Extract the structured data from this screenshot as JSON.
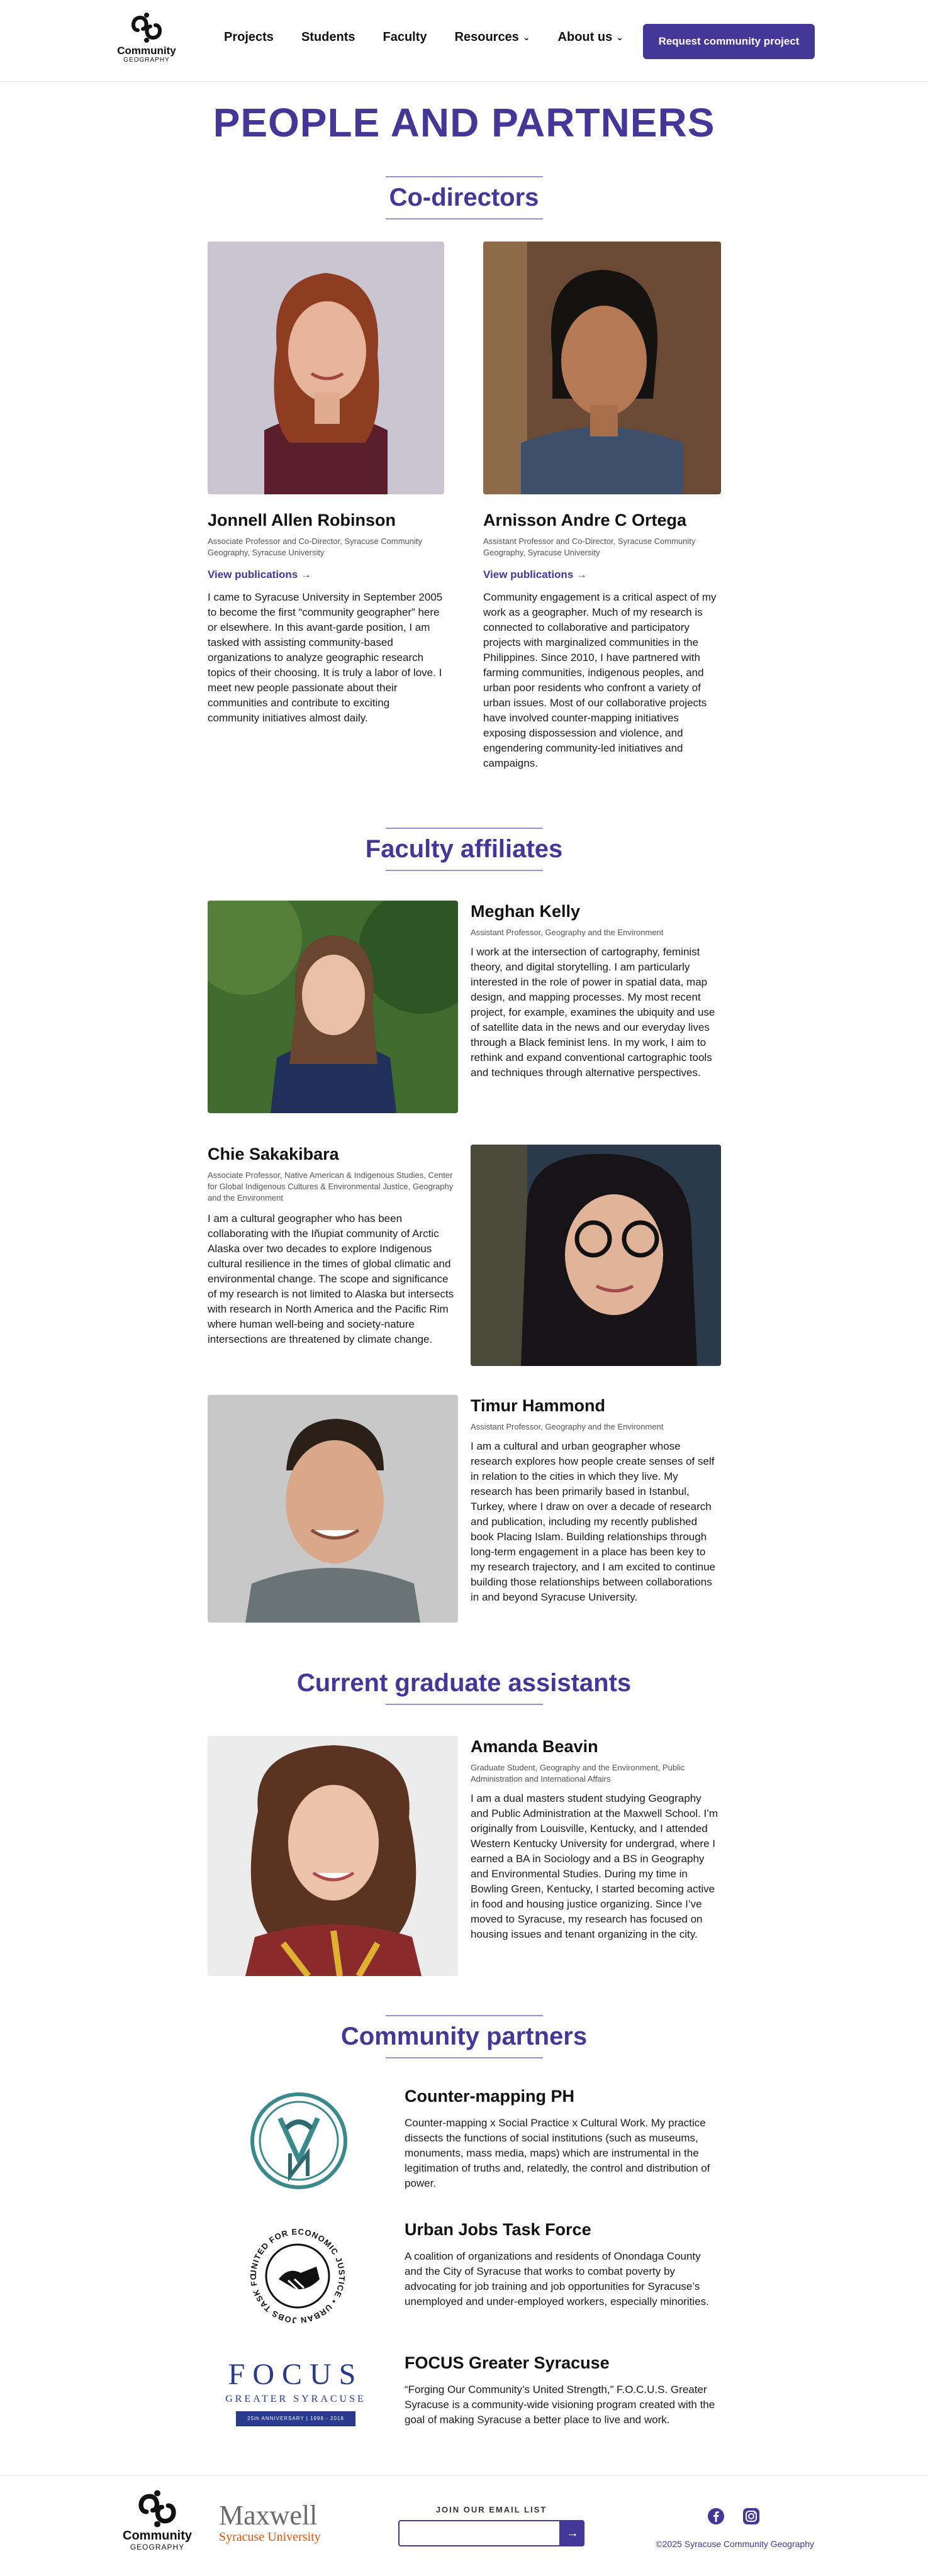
{
  "header": {
    "logo_line1": "Community",
    "logo_line2": "GEOGRAPHY",
    "nav": [
      {
        "label": "Projects"
      },
      {
        "label": "Students"
      },
      {
        "label": "Faculty"
      },
      {
        "label": "Resources",
        "chevron": "chevron-down-icon"
      },
      {
        "label": "About us",
        "chevron": "chevron-down-icon"
      }
    ],
    "cta_label": "Request community project"
  },
  "page_title": "PEOPLE AND PARTNERS",
  "codirectors": {
    "heading": "Co-directors",
    "people": [
      {
        "name": "Jonnell Allen Robinson",
        "role": "Associate Professor and Co-Director, Syracuse Community Geography, Syracuse University",
        "link": "View publications",
        "bio": "I came to Syracuse University in September 2005 to become the first “community geographer” here or elsewhere. In this avant-garde position, I am tasked with assisting community-based organizations to analyze geographic research topics of their choosing. It is truly a labor of love. I meet new people passionate about their communities and contribute to exciting community initiatives almost daily."
      },
      {
        "name": "Arnisson Andre C Ortega",
        "role": "Assistant Professor and Co-Director, Syracuse Community Geography, Syracuse University",
        "link": "View publications",
        "bio": "Community engagement is a critical aspect of my work as a geographer. Much of my research is connected to collaborative and participatory projects with marginalized communities in the Philippines. Since 2010, I have partnered with farming communities, indigenous peoples, and urban poor residents who confront a variety of urban issues. Most of our collaborative projects have involved counter-mapping initiatives exposing dispossession and violence, and engendering community-led initiatives and campaigns."
      }
    ]
  },
  "faculty": {
    "heading": "Faculty affiliates",
    "people": [
      {
        "name": "Meghan Kelly",
        "role": "Assistant Professor, Geography and the Environment",
        "bio": "I work at the intersection of cartography, feminist theory, and digital storytelling. I am particularly interested in the role of power in spatial data, map design, and mapping processes. My most recent project, for example, examines the ubiquity and use of satellite data in the news and our everyday lives through a Black feminist lens. In my work, I aim to rethink and expand conventional cartographic tools and techniques through alternative perspectives."
      },
      {
        "name": "Chie Sakakibara",
        "role": "Associate Professor, Native American & Indigenous Studies, Center for Global Indigenous Cultures & Environmental Justice, Geography and the Environment",
        "bio": "I am a cultural geographer who has been collaborating with the Iñupiat community of Arctic Alaska over two decades to explore Indigenous cultural resilience in the times of global climatic and environmental change. The scope and significance of my research is not limited to Alaska but intersects with research in North America and the Pacific Rim where human well-being and society-nature intersections are threatened by climate change."
      },
      {
        "name": "Timur Hammond",
        "role": "Assistant Professor, Geography and the Environment",
        "bio": "I am a cultural and urban geographer whose research explores how people create senses of self in relation to the cities in which they live. My research has been primarily based in Istanbul, Turkey, where I draw on over a decade of research and publication, including my recently published book Placing Islam. Building relationships through long-term engagement in a place has been key to my research trajectory, and I am excited to continue building those relationships between collaborations in and beyond Syracuse University."
      }
    ]
  },
  "graduates": {
    "heading": "Current graduate assistants",
    "people": [
      {
        "name": "Amanda Beavin",
        "role": "Graduate Student, Geography and the Environment, Public Administration and International Affairs",
        "bio": "I am a dual masters student studying Geography and Public Administration at the Maxwell School. I’m originally from Louisville, Kentucky, and I attended Western Kentucky University for undergrad, where I earned a BA in Sociology and a BS in Geography and Environmental Studies. During my time in Bowling Green, Kentucky, I started becoming active in food and housing justice organizing. Since I’ve moved to Syracuse, my research has focused on housing issues and tenant organizing in the city."
      }
    ]
  },
  "partners": {
    "heading": "Community partners",
    "items": [
      {
        "name": "Counter-mapping PH",
        "logo": "counter-mapping-logo",
        "desc": "Counter-mapping x Social Practice x Cultural Work. My practice dissects the functions of social institutions (such as museums, monuments, mass media, maps) which are instrumental in the legitimation of truths and, relatedly, the control and distribution of power."
      },
      {
        "name": "Urban Jobs Task Force",
        "logo": "urban-jobs-logo",
        "logo_ring_text": "UNITED FOR ECONOMIC JUSTICE • URBAN JOBS TASK FORCE",
        "desc": "A coalition of organizations and residents of Onondaga County and the City of Syracuse that works to combat poverty by advocating for job training and job opportunities for Syracuse’s unemployed and under-employed workers, especially minorities."
      },
      {
        "name": "FOCUS Greater Syracuse",
        "logo": "focus-logo",
        "logo_word": "FOCUS",
        "logo_sub": "GREATER SYRACUSE",
        "logo_band": "25th ANNIVERSARY | 1998 - 2018",
        "desc": "“Forging Our Community’s United Strength,” F.O.C.U.S. Greater Syracuse is a community-wide visioning program created with the goal of making Syracuse a better place to live and work."
      }
    ]
  },
  "footer": {
    "logo_line1": "Community",
    "logo_line2": "GEOGRAPHY",
    "maxwell_line1": "Maxwell",
    "maxwell_line2": "Syracuse University",
    "email_label": "JOIN OUR EMAIL LIST",
    "email_placeholder": "",
    "social": [
      "facebook-icon",
      "instagram-icon"
    ],
    "copyright": "©2025 Syracuse Community Geography"
  },
  "colors": {
    "brand": "#453797",
    "accent_orange": "#d45500",
    "rule": "#9a91c9"
  }
}
